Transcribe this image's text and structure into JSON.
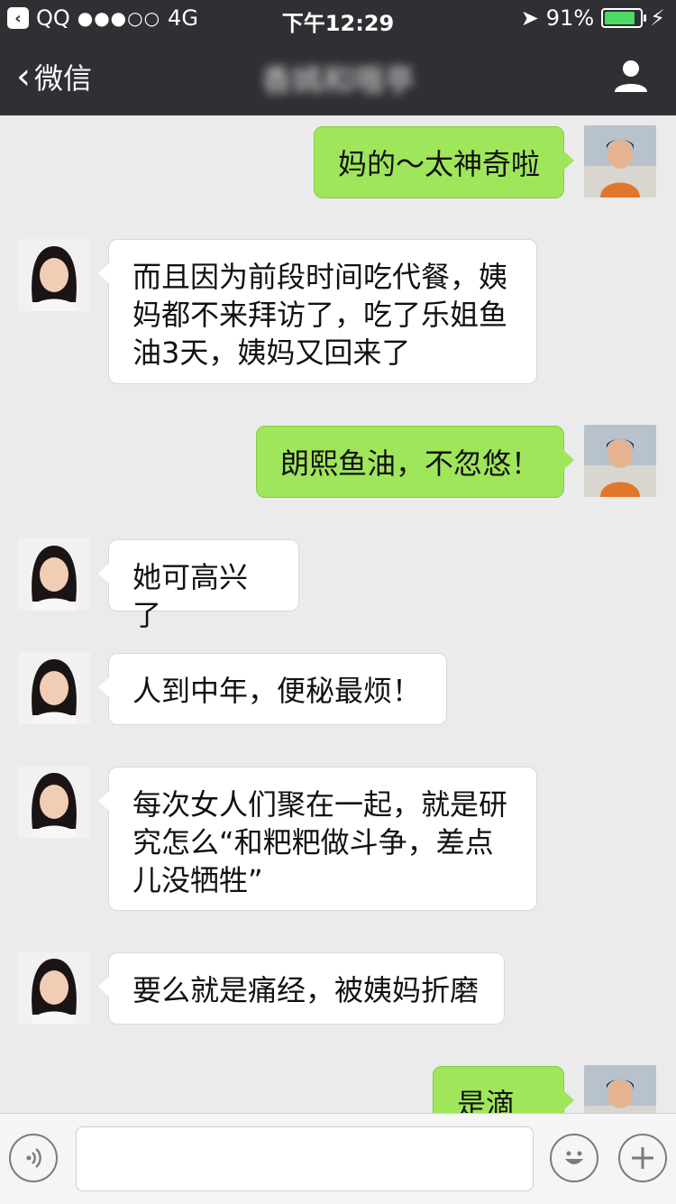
{
  "status_bar": {
    "carrier": "QQ",
    "signal": "●●●○○",
    "network": "4G",
    "time": "下午12:29",
    "battery": "91%",
    "battery_level": 0.91
  },
  "nav": {
    "back_label": "微信",
    "title": "香嫣和哦亭",
    "profile_icon": "person-icon"
  },
  "messages": [
    {
      "side": "out",
      "text": "妈的～太神奇啦"
    },
    {
      "side": "in",
      "text": "而且因为前段时间吃代餐，姨妈都不来拜访了，吃了乐姐鱼油3天，姨妈又回来了"
    },
    {
      "side": "out",
      "text": "朗熙鱼油，不忽悠！"
    },
    {
      "side": "in",
      "text": "她可高兴了"
    },
    {
      "side": "in",
      "text": "人到中年，便秘最烦！"
    },
    {
      "side": "in",
      "text": "每次女人们聚在一起，就是研究怎么“和粑粑做斗争，差点儿没牺牲”"
    },
    {
      "side": "in",
      "text": "要么就是痛经，被姨妈折磨"
    },
    {
      "side": "out",
      "text": "是滴～"
    }
  ],
  "input_bar": {
    "voice_icon": "voice-icon",
    "emoji_icon": "emoji-icon",
    "plus_icon": "plus-icon",
    "placeholder": ""
  },
  "colors": {
    "nav_bg": "#2e3033",
    "chat_bg": "#ebebeb",
    "out_bubble": "#9fe65a",
    "in_bubble": "#ffffff",
    "battery_fill": "#4cd964"
  }
}
